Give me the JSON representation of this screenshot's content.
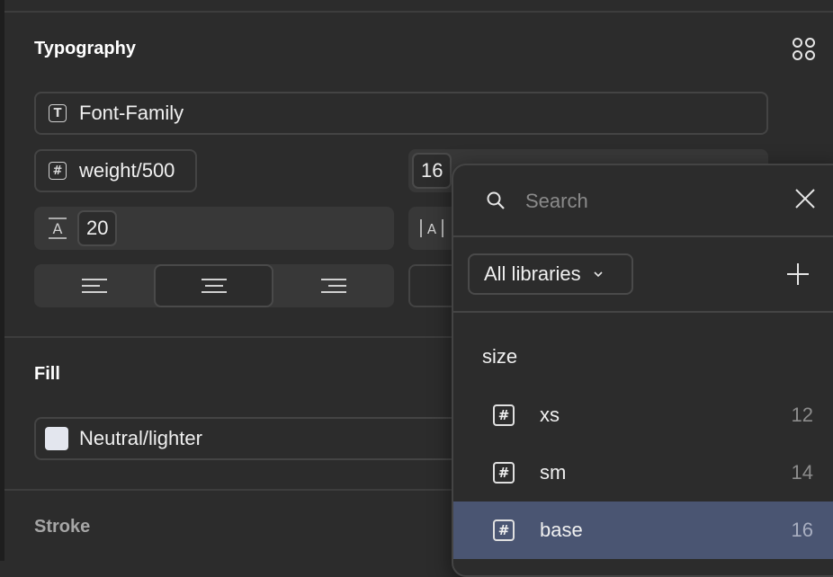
{
  "typography": {
    "title": "Typography",
    "font_family": "Font-Family",
    "weight": "weight/500",
    "size_value": "16",
    "line_height": "20",
    "align_left_label": "Align left",
    "align_center_label": "Align center",
    "align_right_label": "Align right"
  },
  "fill": {
    "title": "Fill",
    "color_name": "Neutral/lighter",
    "color_hex": "#e3e6ee"
  },
  "stroke": {
    "title": "Stroke"
  },
  "popover": {
    "search_placeholder": "Search",
    "library_filter": "All libraries",
    "group": "size",
    "items": [
      {
        "name": "xs",
        "value": "12"
      },
      {
        "name": "sm",
        "value": "14"
      },
      {
        "name": "base",
        "value": "16"
      }
    ],
    "selected_item": "base"
  },
  "colors": {
    "panel_bg": "#2c2c2c",
    "selected_row": "#4a5572"
  }
}
